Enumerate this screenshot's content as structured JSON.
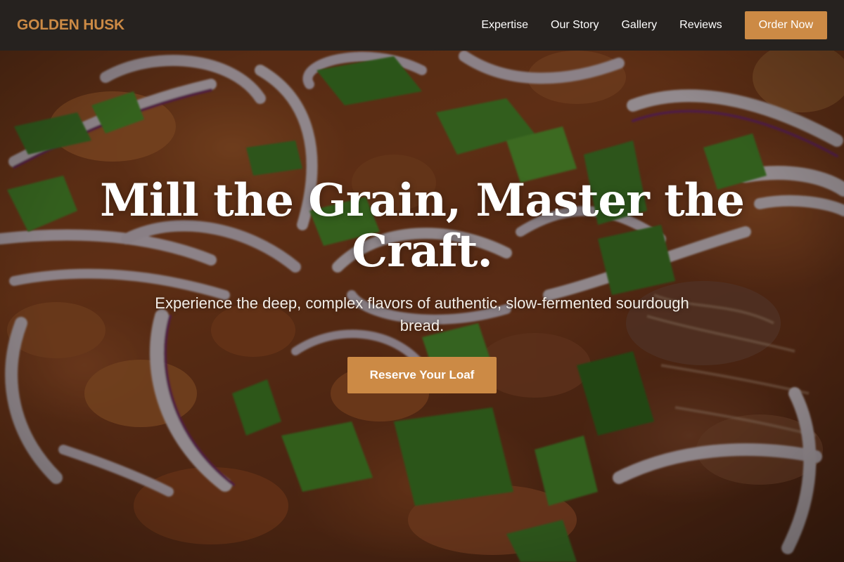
{
  "theme": {
    "accent": "#cc8a45",
    "navbar_bg": "#26221f"
  },
  "brand": {
    "name": "GOLDEN HUSK"
  },
  "nav": {
    "links": [
      {
        "label": "Expertise"
      },
      {
        "label": "Our Story"
      },
      {
        "label": "Gallery"
      },
      {
        "label": "Reviews"
      }
    ],
    "cta_label": "Order Now"
  },
  "hero": {
    "title": "Mill the Grain, Master the Craft.",
    "subtitle": "Experience the deep, complex flavors of authentic, slow-fermented sourdough bread.",
    "cta_label": "Reserve Your Loaf",
    "background_image": "close-up food photo with red onion rings and green onion"
  }
}
